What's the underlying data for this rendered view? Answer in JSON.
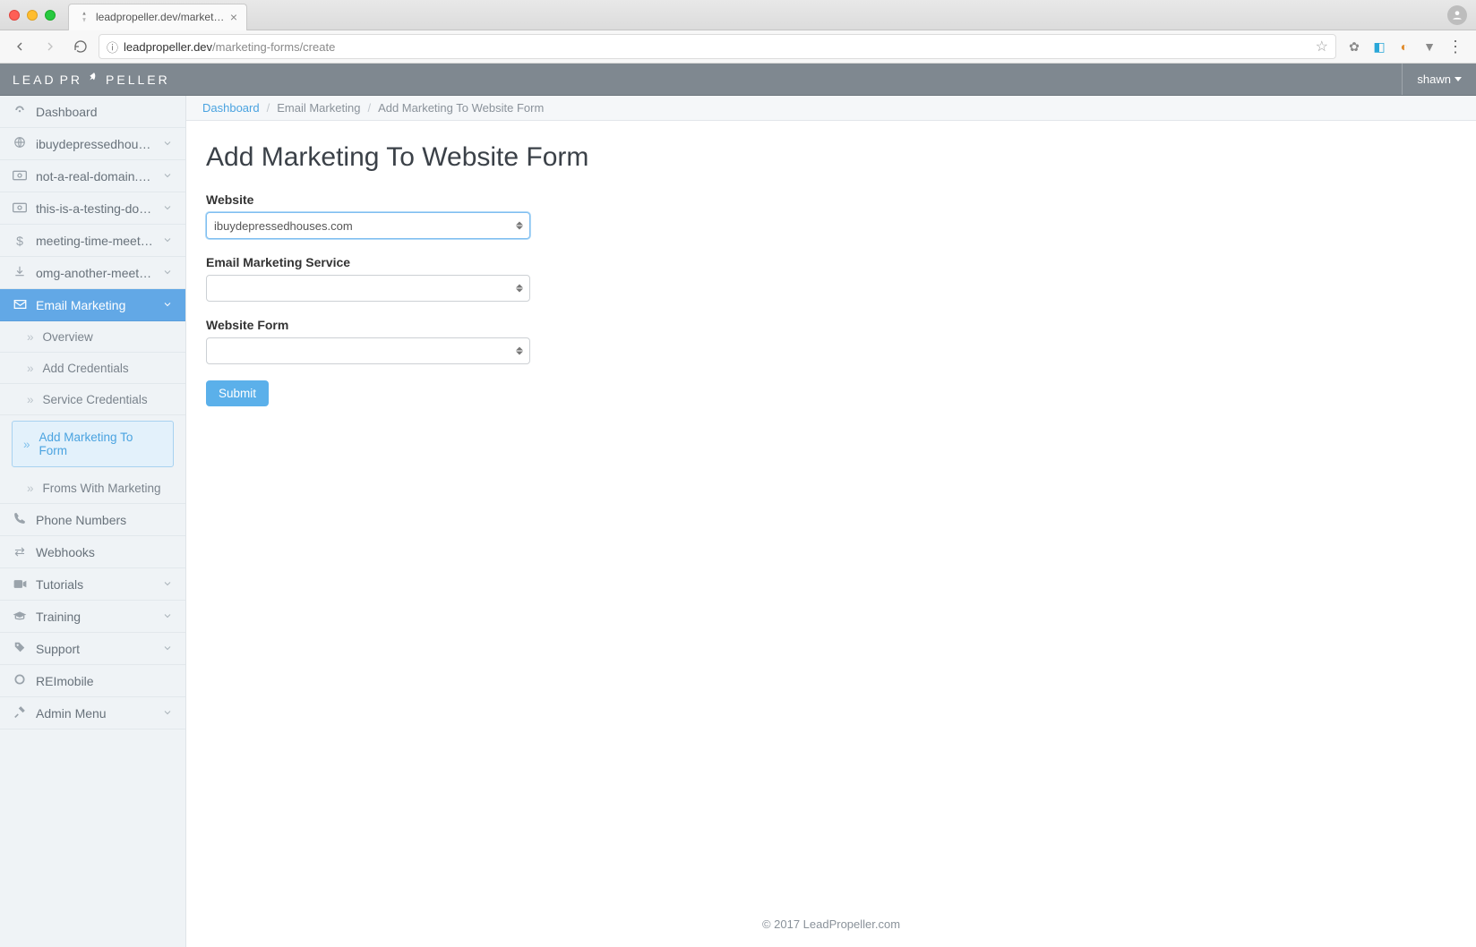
{
  "browser": {
    "tab_title": "leadpropeller.dev/marketing-fo",
    "url_host": "leadpropeller.dev",
    "url_path": "/marketing-forms/create"
  },
  "topbar": {
    "logo_a": "LEAD",
    "logo_b": "PR",
    "logo_c": "PELLER",
    "user": "shawn"
  },
  "sidebar": {
    "items": [
      {
        "icon": "dashboard",
        "label": "Dashboard",
        "chev": false
      },
      {
        "icon": "globe",
        "label": "ibuydepressedhouses.…",
        "chev": true
      },
      {
        "icon": "cash",
        "label": "not-a-real-domain.com",
        "chev": true
      },
      {
        "icon": "cash",
        "label": "this-is-a-testing-domai…",
        "chev": true
      },
      {
        "icon": "dollar",
        "label": "meeting-time-meeting…",
        "chev": true
      },
      {
        "icon": "download",
        "label": "omg-another-meeting.…",
        "chev": true
      },
      {
        "icon": "mail",
        "label": "Email Marketing",
        "chev": true,
        "active": true
      }
    ],
    "email_subitems": [
      {
        "label": "Overview"
      },
      {
        "label": "Add Credentials"
      },
      {
        "label": "Service Credentials"
      },
      {
        "label": "Add Marketing To Form",
        "selected": true
      },
      {
        "label": "Froms With Marketing"
      }
    ],
    "items_after": [
      {
        "icon": "phone",
        "label": "Phone Numbers",
        "chev": false
      },
      {
        "icon": "swap",
        "label": "Webhooks",
        "chev": false
      },
      {
        "icon": "video",
        "label": "Tutorials",
        "chev": true
      },
      {
        "icon": "grad",
        "label": "Training",
        "chev": true
      },
      {
        "icon": "tag",
        "label": "Support",
        "chev": true
      },
      {
        "icon": "ring",
        "label": "REImobile",
        "chev": false
      },
      {
        "icon": "tools",
        "label": "Admin Menu",
        "chev": true
      }
    ]
  },
  "breadcrumb": {
    "a": "Dashboard",
    "b": "Email Marketing",
    "c": "Add Marketing To Website Form"
  },
  "page": {
    "title": "Add Marketing To Website Form",
    "website_label": "Website",
    "website_selected": "ibuydepressedhouses.com",
    "service_label": "Email Marketing Service",
    "service_selected": "",
    "form_label": "Website Form",
    "form_selected": "",
    "submit": "Submit"
  },
  "footer": {
    "text": "© 2017 LeadPropeller.com"
  }
}
